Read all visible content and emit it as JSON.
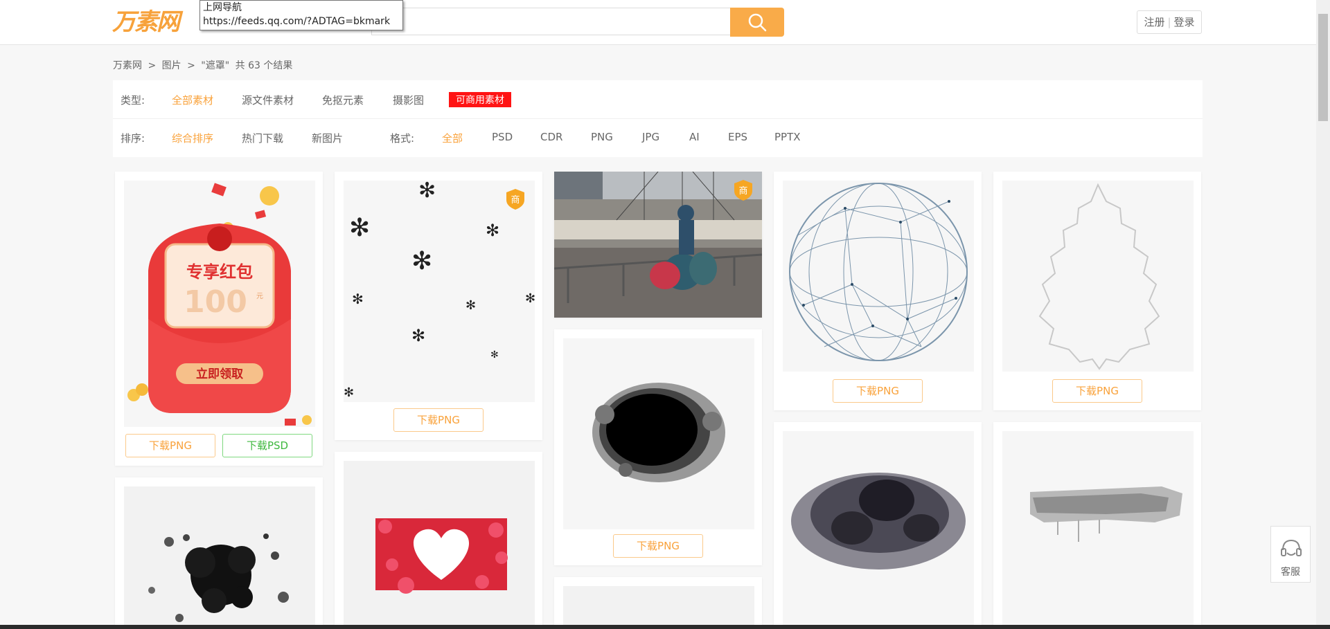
{
  "header": {
    "logo_text": "万素网",
    "search_placeholder": "",
    "auth": {
      "register": "注册",
      "separator": "|",
      "login": "登录"
    }
  },
  "tooltip": {
    "title": "上网导航",
    "url": "https://feeds.qq.com/?ADTAG=bkmark"
  },
  "breadcrumb": {
    "home": "万素网",
    "sep": ">",
    "section": "图片",
    "query": "\"遮罩\"",
    "result_text": "共 63 个结果"
  },
  "filters": {
    "type_label": "类型:",
    "types": [
      {
        "label": "全部素材",
        "active": true
      },
      {
        "label": "源文件素材",
        "active": false
      },
      {
        "label": "免抠元素",
        "active": false
      },
      {
        "label": "摄影图",
        "active": false
      },
      {
        "label": "可商用素材",
        "badge": true
      }
    ],
    "sort_label": "排序:",
    "sorts": [
      {
        "label": "综合排序",
        "active": true
      },
      {
        "label": "热门下载",
        "active": false
      },
      {
        "label": "新图片",
        "active": false
      }
    ],
    "format_label": "格式:",
    "formats": [
      {
        "label": "全部",
        "active": true
      },
      {
        "label": "PSD",
        "active": false
      },
      {
        "label": "CDR",
        "active": false
      },
      {
        "label": "PNG",
        "active": false
      },
      {
        "label": "JPG",
        "active": false
      },
      {
        "label": "AI",
        "active": false
      },
      {
        "label": "EPS",
        "active": false
      },
      {
        "label": "PPTX",
        "active": false
      }
    ]
  },
  "cards": {
    "red_envelope": {
      "headline": "专享红包",
      "amount": "100",
      "unit": "元",
      "cta": "立即领取",
      "btn_png": "下载PNG",
      "btn_psd": "下载PSD"
    },
    "flowers": {
      "btn": "下载PNG",
      "badge": "商"
    },
    "photo": {
      "badge": "商"
    },
    "ink_blob": {
      "btn": "下载PNG"
    },
    "sphere": {
      "btn": "下载PNG"
    },
    "leaf": {
      "btn": "下载PNG"
    }
  },
  "service": {
    "label": "客服"
  },
  "colors": {
    "accent": "#f9a23b",
    "badge_red": "#ff1414",
    "psd_green": "#3fb83f",
    "search_btn": "#f9ab49"
  }
}
